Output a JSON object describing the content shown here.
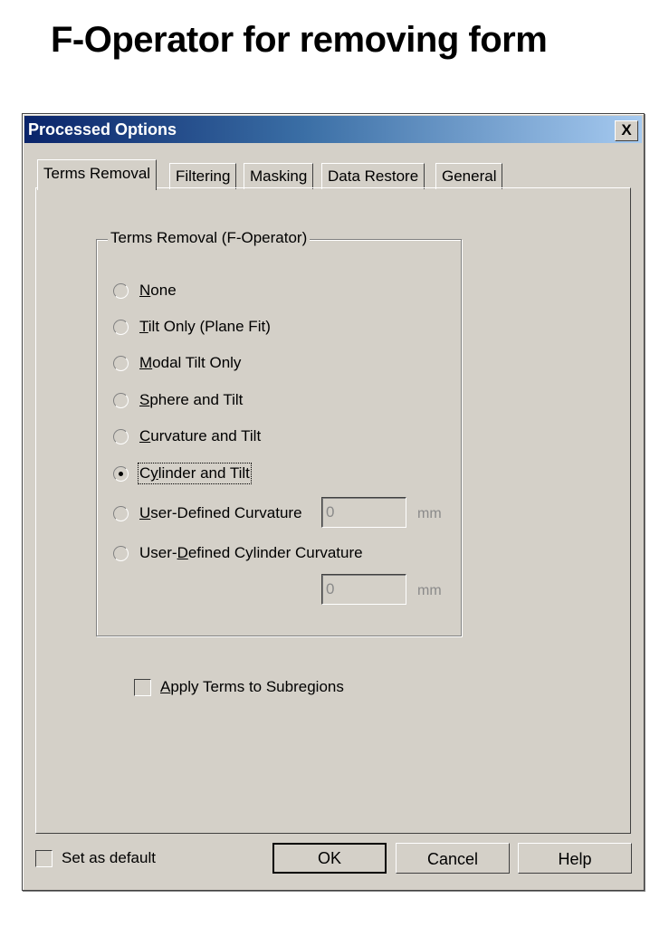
{
  "slide": {
    "title": "F-Operator for removing form"
  },
  "dialog": {
    "title": "Processed Options",
    "close_label": "X",
    "tabs": [
      {
        "label": "Terms Removal",
        "active": true
      },
      {
        "label": "Filtering",
        "active": false
      },
      {
        "label": "Masking",
        "active": false
      },
      {
        "label": "Data Restore",
        "active": false
      },
      {
        "label": "General",
        "active": false
      }
    ],
    "group": {
      "label": "Terms Removal  (F-Operator)",
      "options": [
        {
          "label": "None",
          "accel": "N",
          "rest": "one",
          "selected": false
        },
        {
          "label": "Tilt Only (Plane Fit)",
          "accel": "T",
          "rest": "ilt Only (Plane Fit)",
          "selected": false
        },
        {
          "label": "Modal Tilt Only",
          "accel": "M",
          "rest": "odal Tilt Only",
          "selected": false
        },
        {
          "label": "Sphere and Tilt",
          "accel": "S",
          "rest": "phere and Tilt",
          "selected": false
        },
        {
          "label": "Curvature and Tilt",
          "accel": "C",
          "rest": "urvature and Tilt",
          "selected": false
        },
        {
          "label": "Cylinder and Tilt",
          "pre": "C",
          "accel": "y",
          "rest": "linder and Tilt",
          "selected": true
        },
        {
          "label": "User-Defined Curvature",
          "accel": "U",
          "rest": "ser-Defined Curvature",
          "selected": false
        },
        {
          "label": "User-Defined Cylinder Curvature",
          "pre": "User-",
          "accel": "D",
          "rest": "efined Cylinder Curvature",
          "selected": false
        }
      ],
      "curvature_value": "0",
      "curvature_unit": "mm",
      "cylinder_value": "0",
      "cylinder_unit": "mm"
    },
    "apply_subregions": {
      "accel": "A",
      "rest": "pply Terms to Subregions",
      "checked": false
    },
    "set_default": {
      "label": "Set as default",
      "checked": false
    },
    "buttons": {
      "ok": "OK",
      "cancel": "Cancel",
      "help": "Help"
    }
  }
}
